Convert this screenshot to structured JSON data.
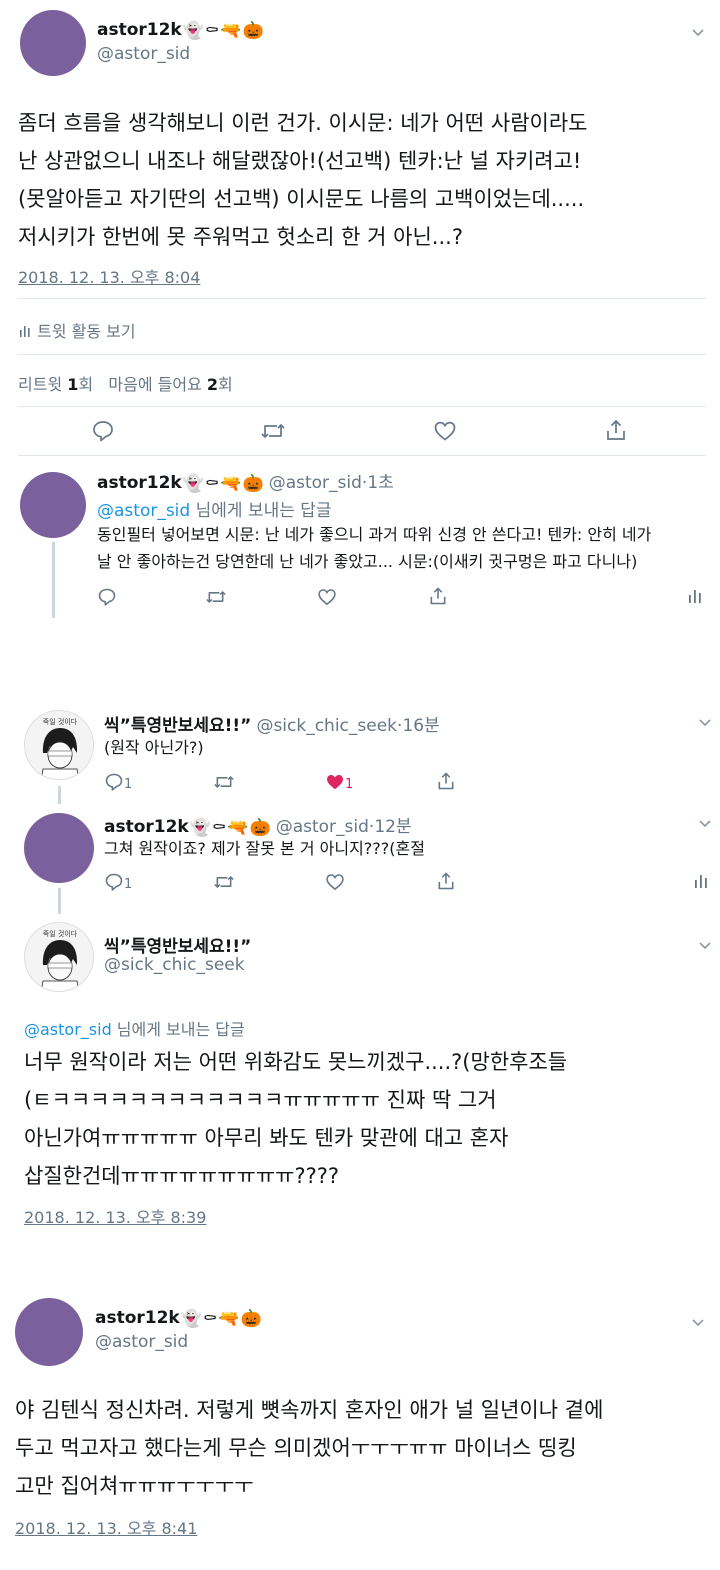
{
  "tweet1": {
    "name": "astor12k",
    "handle": "@astor_sid",
    "emojis": [
      "👻",
      "⚰",
      "🔫",
      "🎃"
    ],
    "lines": [
      "좀더 흐름을 생각해보니 이런 건가. 이시문: 네가 어떤 사람이라도",
      "난 상관없으니 내조나 해달랬잖아!(선고백) 텐카:난 널 자키려고!",
      "(못알아듣고 자기딴의 선고백) 이시문도 나름의 고백이었는데.....",
      "저시키가 한번에 못 주워먹고 헛소리 한 거 아닌...?"
    ],
    "date": "2018. 12. 13. 오후 8:04",
    "activity": "트윗 활동 보기",
    "retweet_label": "리트윗",
    "retweet_count": "1",
    "retweet_unit": "회",
    "like_label": "마음에 들어요",
    "like_count": "2",
    "like_unit": "회"
  },
  "reply1": {
    "name": "astor12k",
    "handle": "@astor_sid",
    "time": "1초",
    "reply_to_handle": "@astor_sid",
    "reply_to_suffix": " 님에게 보내는 답글",
    "lines": [
      "동인필터 넣어보면 시문: 난 네가 좋으니 과거 따위 신경 안 쓴다고! 텐카: 안히 네가",
      "날 안 좋아하는건 당연한데 난 네가 좋았고... 시문:(이새키 귓구멍은 파고 다니나)"
    ]
  },
  "reply2": {
    "name": "씩”특영반보세요!!”",
    "handle": "@sick_chic_seek",
    "time": "16분",
    "text": "(원작 아닌가?)",
    "reply_count": "1",
    "like_count": "1"
  },
  "reply3": {
    "name": "astor12k",
    "handle": "@astor_sid",
    "time": "12분",
    "text": "그쳐 원작이죠? 제가 잘못 본 거 아니지???(혼절",
    "reply_count": "1"
  },
  "tweet2": {
    "name": "씩”특영반보세요!!”",
    "handle": "@sick_chic_seek",
    "reply_to_handle": "@astor_sid",
    "reply_to_suffix": " 님에게 보내는 답글",
    "lines": [
      "너무 원작이라 저는 어떤 위화감도 못느끼겠구....?(망한후조들",
      "(ㅌㅋㅋㅋㅋㅋㅋㅋㅋㅋㅋㅋㅋㅠㅠㅠㅠㅠ 진짜 딱 그거",
      "아닌가여ㅠㅠㅠㅠㅠ 아무리 봐도 텐카 맞관에 대고 혼자",
      "삽질한건데ㅠㅠㅠㅠㅠㅠㅠㅠㅠ????"
    ],
    "date": "2018. 12. 13. 오후 8:39"
  },
  "tweet3": {
    "name": "astor12k",
    "handle": "@astor_sid",
    "lines": [
      "야 김텐식 정신차려. 저렇게 뼛속까지 혼자인 애가 널 일년이나 곁에",
      "두고 먹고자고 했다는게 무슨 의미겠어ㅜㅜㅜㅠㅠ 마이너스 띵킹",
      "고만 집어쳐ㅠㅠㅠㅜㅜㅜㅜ"
    ],
    "date": "2018. 12. 13. 오후 8:41"
  },
  "avatar_caption": "죽일 것이다",
  "colors": {
    "avatar": "#7a619e",
    "link": "#1b95e0",
    "muted": "#657786",
    "like": "#e0245e"
  },
  "icons": [
    "chevron-down-icon",
    "reply-icon",
    "retweet-icon",
    "like-icon",
    "share-icon",
    "analytics-icon"
  ]
}
